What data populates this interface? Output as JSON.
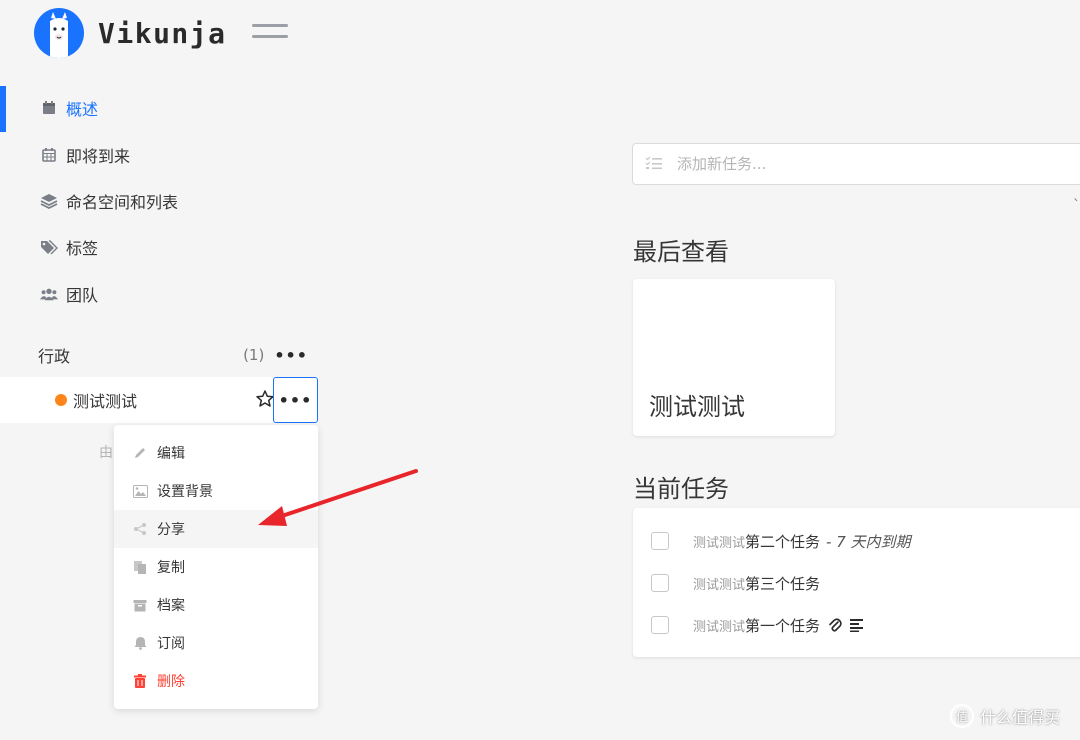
{
  "app": {
    "name": "Vikunja"
  },
  "sidebar": {
    "items": [
      {
        "label": "概述",
        "icon": "calendar-icon",
        "active": true
      },
      {
        "label": "即将到来",
        "icon": "calendar-grid-icon",
        "active": false
      },
      {
        "label": "命名空间和列表",
        "icon": "layers-icon",
        "active": false
      },
      {
        "label": "标签",
        "icon": "tags-icon",
        "active": false
      },
      {
        "label": "团队",
        "icon": "users-icon",
        "active": false
      }
    ],
    "namespace": {
      "title": "行政",
      "count": "(1)",
      "more": "•••"
    },
    "list": {
      "title": "测试测试",
      "color": "#ff851b",
      "more": "•••"
    },
    "faint_text": "由"
  },
  "dropdown": {
    "items": [
      {
        "label": "编辑",
        "icon": "pencil-icon"
      },
      {
        "label": "设置背景",
        "icon": "image-icon"
      },
      {
        "label": "分享",
        "icon": "share-icon"
      },
      {
        "label": "复制",
        "icon": "copy-icon"
      },
      {
        "label": "档案",
        "icon": "archive-icon"
      },
      {
        "label": "订阅",
        "icon": "bell-icon"
      },
      {
        "label": "删除",
        "icon": "trash-icon"
      }
    ]
  },
  "main": {
    "add_task": {
      "placeholder": "添加新任务..."
    },
    "edge_mark": "`",
    "last_viewed": {
      "title": "最后查看",
      "cards": [
        {
          "title": "测试测试"
        }
      ]
    },
    "current_tasks": {
      "title": "当前任务",
      "tasks": [
        {
          "list": "测试测试",
          "title": "第二个任务",
          "due": "- 7 天内到期"
        },
        {
          "list": "测试测试",
          "title": "第三个任务",
          "due": ""
        },
        {
          "list": "测试测试",
          "title": "第一个任务",
          "due": ""
        }
      ]
    }
  },
  "watermark": {
    "glyph": "值",
    "text": "什么值得买"
  },
  "colors": {
    "primary": "#1973ff",
    "danger": "#ff4136",
    "list_dot": "#ff851b",
    "annotation_arrow": "#e8252a"
  }
}
